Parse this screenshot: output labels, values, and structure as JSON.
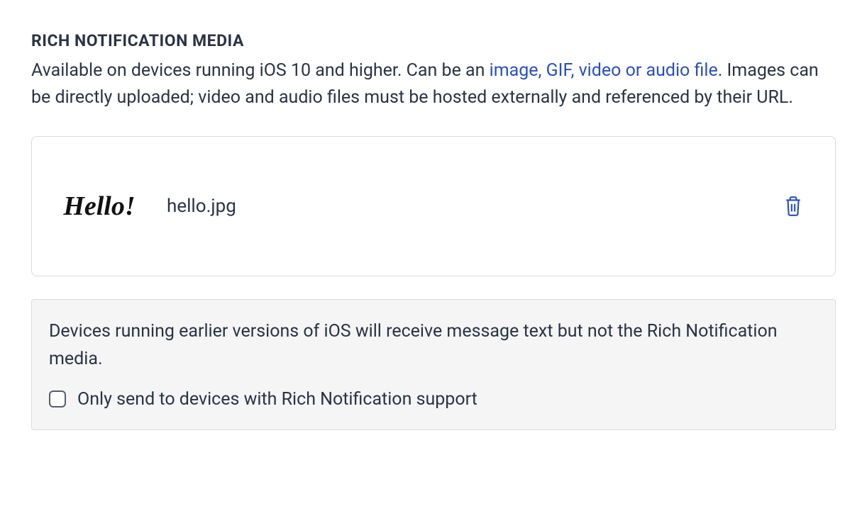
{
  "section": {
    "title": "RICH NOTIFICATION MEDIA",
    "description_prefix": "Available on devices running iOS 10 and higher. Can be an ",
    "description_link": "image, GIF, video or audio file",
    "description_suffix": ". Images can be directly uploaded; video and audio files must be hosted externally and referenced by their URL."
  },
  "media": {
    "thumb_text": "Hello!",
    "filename": "hello.jpg"
  },
  "info_panel": {
    "notice": "Devices running earlier versions of iOS will receive message text but not the Rich Notification media.",
    "checkbox_label": "Only send to devices with Rich Notification support",
    "checkbox_checked": false
  }
}
